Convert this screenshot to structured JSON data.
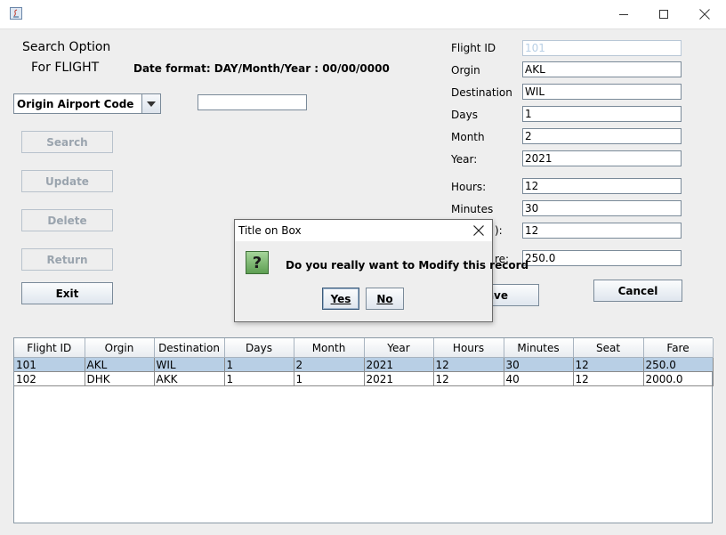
{
  "window": {
    "controls": [
      "minimize-icon",
      "maximize-icon",
      "close-icon"
    ]
  },
  "search": {
    "title": "Search Option",
    "subtitle": "For FLIGHT",
    "date_format": "Date format: DAY/Month/Year : 00/00/0000",
    "dropdown_selected": "Origin Airport Code",
    "query_value": ""
  },
  "buttons": {
    "search": "Search",
    "update": "Update",
    "delete": "Delete",
    "return": "Return",
    "exit": "Exit",
    "save": "ave",
    "cancel": "Cancel"
  },
  "form": {
    "flight_id_label": "Flight ID",
    "flight_id": "101",
    "origin_label": "Orgin",
    "origin": "AKL",
    "destination_label": "Destination",
    "destination": "WIL",
    "days_label": "Days",
    "days": "1",
    "month_label": "Month",
    "month": "2",
    "year_label": "Year:",
    "year": "2021",
    "hours_label": "Hours:",
    "hours": "12",
    "minutes_label": "Minutes",
    "minutes": "30",
    "seat_label_partial": "):",
    "seat": "12",
    "fare_label_partial": "re:",
    "fare": "250.0"
  },
  "table": {
    "columns": [
      "Flight ID",
      "Orgin",
      "Destination",
      "Days",
      "Month",
      "Year",
      "Hours",
      "Minutes",
      "Seat",
      "Fare"
    ],
    "rows": [
      [
        "101",
        "AKL",
        "WIL",
        "1",
        "2",
        "2021",
        "12",
        "30",
        "12",
        "250.0"
      ],
      [
        "102",
        "DHK",
        "AKK",
        "1",
        "1",
        "2021",
        "12",
        "40",
        "12",
        "2000.0"
      ]
    ],
    "selected_row": 0
  },
  "dialog": {
    "title": "Title on Box",
    "message": "Do you really want to Modify this record",
    "yes": "Yes",
    "no": "No",
    "icon": "question-icon"
  },
  "colors": {
    "selection": "#b8cfe5",
    "background": "#eeeeee",
    "question_icon": "#6fb35f"
  }
}
